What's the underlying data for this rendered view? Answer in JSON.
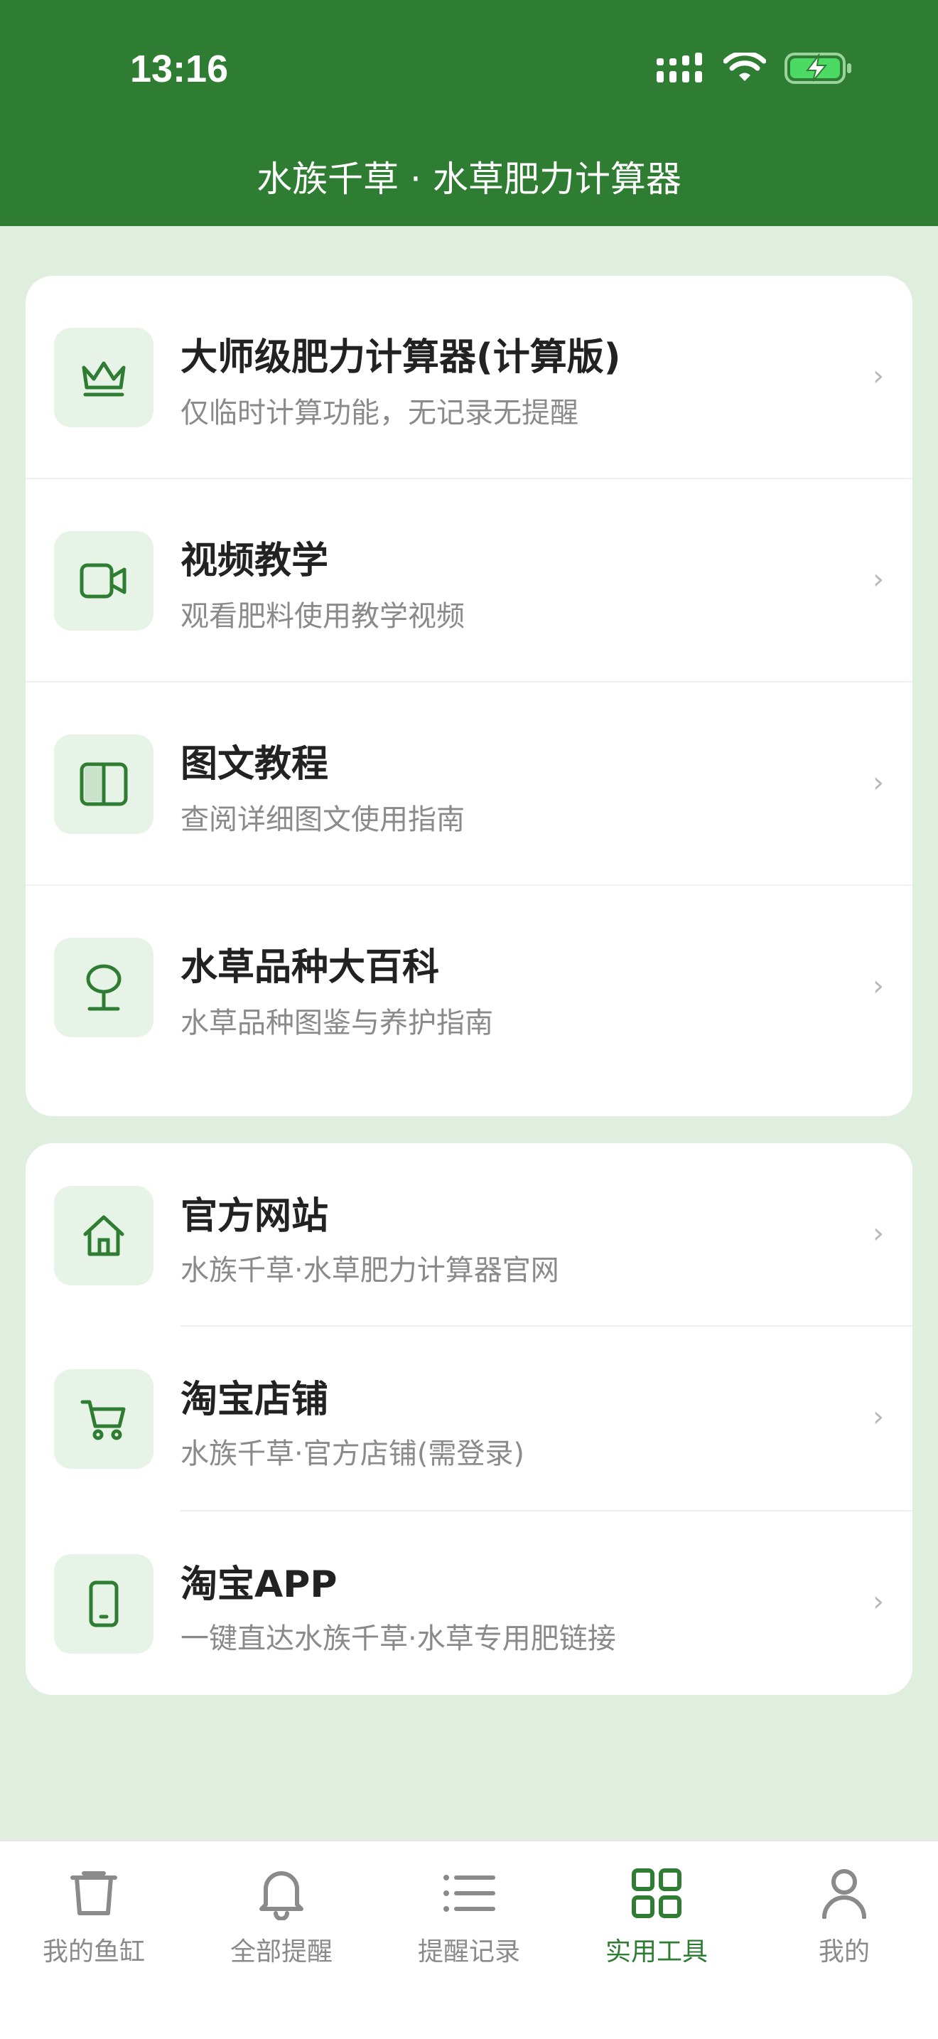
{
  "status_bar": {
    "time": "13:16"
  },
  "header": {
    "title": "水族千草 · 水草肥力计算器"
  },
  "tools_card": {
    "items": [
      {
        "icon": "crown-icon",
        "title": "大师级肥力计算器(计算版)",
        "subtitle": "仅临时计算功能，无记录无提醒"
      },
      {
        "icon": "video-icon",
        "title": "视频教学",
        "subtitle": "观看肥料使用教学视频"
      },
      {
        "icon": "book-icon",
        "title": "图文教程",
        "subtitle": "查阅详细图文使用指南"
      },
      {
        "icon": "plant-icon",
        "title": "水草品种大百科",
        "subtitle": "水草品种图鉴与养护指南"
      }
    ]
  },
  "links_card": {
    "items": [
      {
        "icon": "home-icon",
        "title": "官方网站",
        "subtitle": "水族千草·水草肥力计算器官网"
      },
      {
        "icon": "cart-icon",
        "title": "淘宝店铺",
        "subtitle": "水族千草·官方店铺(需登录)"
      },
      {
        "icon": "phone-icon",
        "title": "淘宝APP",
        "subtitle": "一键直达水族千草·水草专用肥链接"
      }
    ]
  },
  "chevron": "›",
  "tabbar": {
    "tabs": [
      {
        "icon": "tank-icon",
        "label": "我的鱼缸"
      },
      {
        "icon": "bell-icon",
        "label": "全部提醒"
      },
      {
        "icon": "list-icon",
        "label": "提醒记录"
      },
      {
        "icon": "grid-icon",
        "label": "实用工具"
      },
      {
        "icon": "user-icon",
        "label": "我的"
      }
    ],
    "active_index": 3
  },
  "colors": {
    "brand": "#2f7d32",
    "background": "#e0eee0",
    "icon_bg": "#e6f3e6"
  }
}
